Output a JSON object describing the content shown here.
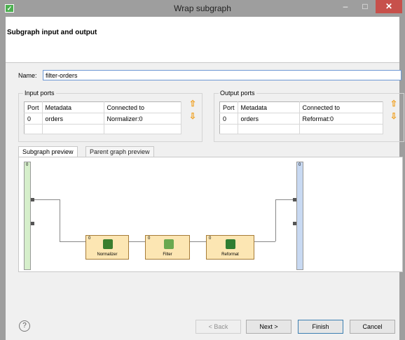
{
  "window": {
    "title": "Wrap subgraph",
    "min_glyph": "–",
    "max_glyph": "□",
    "close_glyph": "✕"
  },
  "header": {
    "title": "Subgraph input and output"
  },
  "name": {
    "label": "Name:",
    "value": "filter-orders"
  },
  "input_ports": {
    "legend": "Input ports",
    "columns": [
      "Port",
      "Metadata",
      "Connected to"
    ],
    "rows": [
      [
        "0",
        "orders",
        "Normalizer:0"
      ]
    ]
  },
  "output_ports": {
    "legend": "Output ports",
    "columns": [
      "Port",
      "Metadata",
      "Connected to"
    ],
    "rows": [
      [
        "0",
        "orders",
        "Reformat:0"
      ]
    ]
  },
  "icons": {
    "up": "⇧",
    "down": "⇩"
  },
  "tabs": [
    "Subgraph preview",
    "Parent graph preview"
  ],
  "preview": {
    "bar_label": "0",
    "components": [
      {
        "label": "Normalizer",
        "port": "0",
        "icon_color": "#3a7d2e"
      },
      {
        "label": "Filter",
        "port": "0",
        "icon_color": "#6aa84f"
      },
      {
        "label": "Reformat",
        "port": "0",
        "icon_color": "#2e7d32"
      }
    ]
  },
  "footer": {
    "help": "?",
    "back": "< Back",
    "next": "Next >",
    "finish": "Finish",
    "cancel": "Cancel"
  },
  "colors": {
    "accent": "#3c7fb1",
    "close_button": "#c7504b",
    "component_fill": "#fce6b3",
    "input_bar": "#d6efcb",
    "output_bar": "#c8d9f2"
  }
}
